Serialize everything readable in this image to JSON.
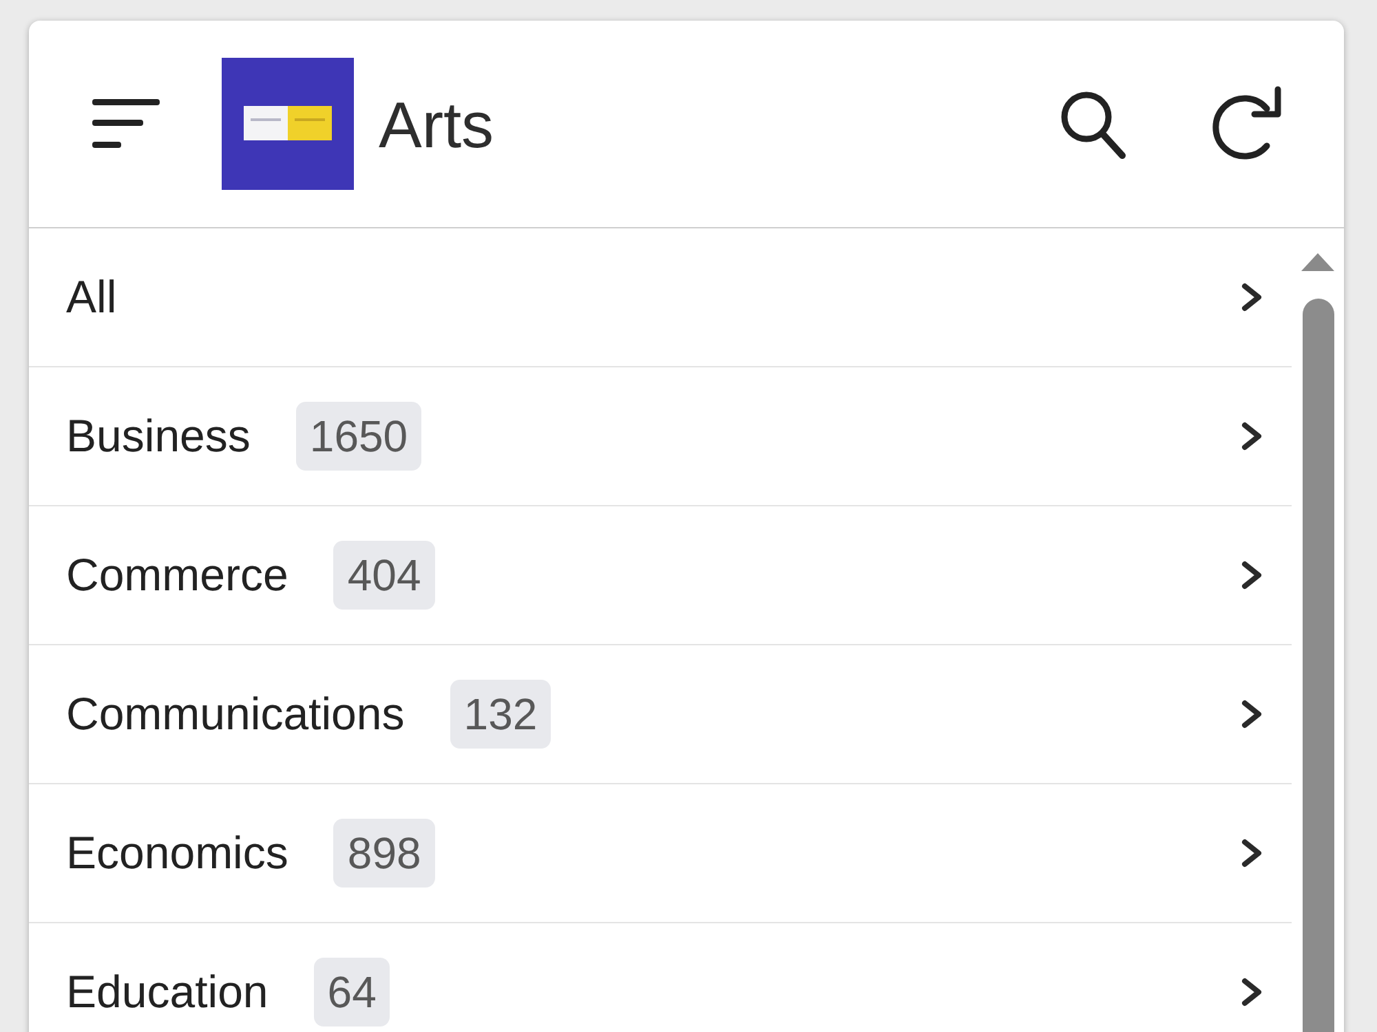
{
  "header": {
    "title": "Arts"
  },
  "categories": [
    {
      "name": "All"
    },
    {
      "name": "Business",
      "count": "1650"
    },
    {
      "name": "Commerce",
      "count": "404"
    },
    {
      "name": "Communications",
      "count": "132"
    },
    {
      "name": "Economics",
      "count": "898"
    },
    {
      "name": "Education",
      "count": "64"
    }
  ]
}
